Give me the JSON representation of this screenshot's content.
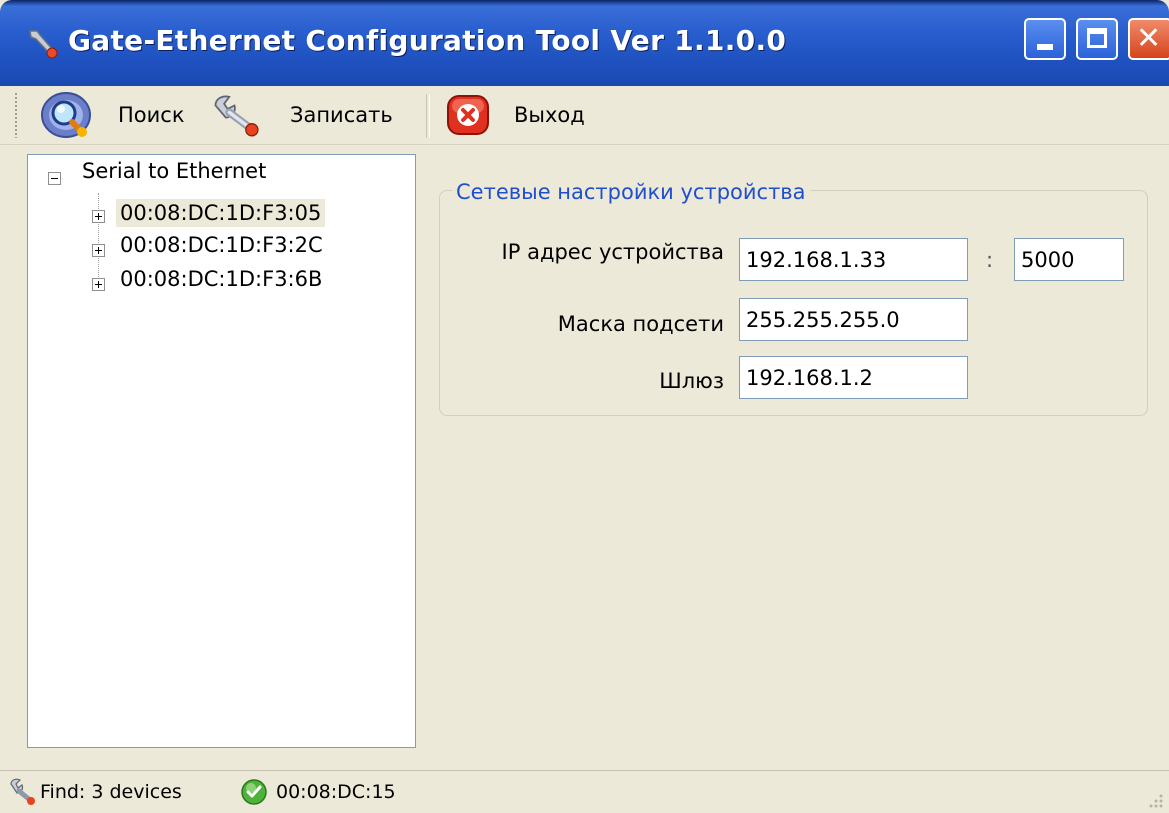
{
  "window": {
    "title": "Gate-Ethernet Configuration Tool Ver 1.1.0.0"
  },
  "toolbar": {
    "search_label": "Поиск",
    "save_label": "Записать",
    "exit_label": "Выход"
  },
  "tree": {
    "root_label": "Serial to Ethernet",
    "items": [
      {
        "label": "00:08:DC:1D:F3:05",
        "selected": true
      },
      {
        "label": "00:08:DC:1D:F3:2C",
        "selected": false
      },
      {
        "label": "00:08:DC:1D:F3:6B",
        "selected": false
      }
    ]
  },
  "settings": {
    "group_title": "Сетевые настройки устройства",
    "ip_label": "IP адрес устройства",
    "ip_value": "192.168.1.33",
    "port_separator": ":",
    "port_value": "5000",
    "mask_label": "Маска подсети",
    "mask_value": "255.255.255.0",
    "gateway_label": "Шлюз",
    "gateway_value": "192.168.1.2"
  },
  "status": {
    "find_text": "Find: 3 devices",
    "device_text": "00:08:DC:15"
  },
  "icons": {
    "title": "wrench-icon",
    "search": "magnifier-icon",
    "save": "wrench-icon",
    "exit": "close-icon",
    "status_find": "wrench-icon",
    "status_device": "ok-icon"
  },
  "colors": {
    "titlebar": "#2a5fcf",
    "window_bg": "#ece9d8",
    "group_title": "#1f4fcf",
    "selection": "#ece9d8"
  }
}
